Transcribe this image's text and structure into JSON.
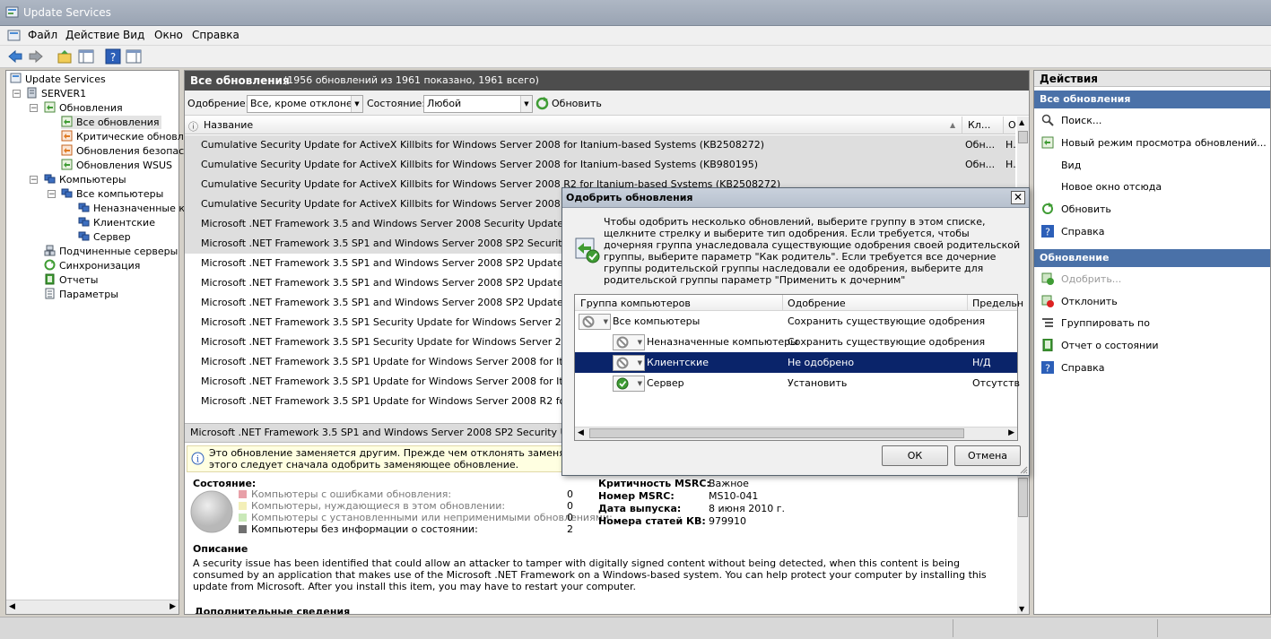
{
  "window": {
    "title": "Update Services"
  },
  "menu": [
    "Файл",
    "Действие",
    "Вид",
    "Окно",
    "Справка"
  ],
  "tree": {
    "root": "Update Services",
    "server": "SERVER1",
    "updates": "Обновления",
    "updates_children": [
      "Все обновления",
      "Критические обновле",
      "Обновления безопасн",
      "Обновления WSUS"
    ],
    "computers": "Компьютеры",
    "all_computers": "Все компьютеры",
    "computer_groups": [
      "Неназначенные к",
      "Клиентские",
      "Сервер"
    ],
    "other": [
      "Подчиненные серверы",
      "Синхронизация",
      "Отчеты",
      "Параметры"
    ]
  },
  "center": {
    "title": "Все обновления",
    "count": "(1956 обновлений из 1961 показано, 1961 всего)",
    "approval_label": "Одобрение:",
    "approval_value": "Все, кроме отклонен",
    "status_label": "Состояние:",
    "status_value": "Любой",
    "refresh_label": "Обновить",
    "columns": {
      "name": "Название",
      "classification": "Кл...",
      "approval": "О"
    },
    "rows": [
      {
        "name": "Cumulative Security Update for ActiveX Killbits for Windows Server 2008 for Itanium-based Systems (KB2508272)",
        "c1": "Обн...",
        "c2": "Н..",
        "grey": true
      },
      {
        "name": "Cumulative Security Update for ActiveX Killbits for Windows Server 2008 for Itanium-based Systems (KB980195)",
        "c1": "Обн...",
        "c2": "Н..",
        "grey": true
      },
      {
        "name": "Cumulative Security Update for ActiveX Killbits for Windows Server 2008 R2 for Itanium-based Systems (KB2508272)",
        "c1": "",
        "c2": "",
        "grey": true
      },
      {
        "name": "Cumulative Security Update for ActiveX Killbits for Windows Server 2008 R2 for Itaniu",
        "c1": "",
        "c2": "",
        "grey": true
      },
      {
        "name": "Microsoft .NET Framework 3.5 and Windows Server 2008 Security Update for Itaniu",
        "c1": "",
        "c2": "",
        "grey": true
      },
      {
        "name": "Microsoft .NET Framework 3.5 SP1 and Windows Server 2008 SP2 Security Update",
        "c1": "",
        "c2": "",
        "grey": true
      },
      {
        "name": "Microsoft .NET Framework 3.5 SP1 and Windows Server 2008 SP2 Update for Itaniu",
        "c1": "",
        "c2": "",
        "grey": false
      },
      {
        "name": "Microsoft .NET Framework 3.5 SP1 and Windows Server 2008 SP2 Update for Itaniu",
        "c1": "",
        "c2": "",
        "grey": false
      },
      {
        "name": "Microsoft .NET Framework 3.5 SP1 and Windows Server 2008 SP2 Update for Itaniu",
        "c1": "",
        "c2": "",
        "grey": false
      },
      {
        "name": "Microsoft .NET Framework 3.5 SP1 Security Update for Windows Server 2008 for It",
        "c1": "",
        "c2": "",
        "grey": false
      },
      {
        "name": "Microsoft .NET Framework 3.5 SP1 Security Update for Windows Server 2008 R2 fo",
        "c1": "",
        "c2": "",
        "grey": false
      },
      {
        "name": "Microsoft .NET Framework 3.5 SP1 Update for Windows Server 2008 for Itanium-ba",
        "c1": "",
        "c2": "",
        "grey": false
      },
      {
        "name": "Microsoft .NET Framework 3.5 SP1 Update for Windows Server 2008 for Itanium-ba",
        "c1": "",
        "c2": "",
        "grey": false
      },
      {
        "name": "Microsoft .NET Framework 3.5 SP1 Update for Windows Server 2008 R2 for Itanium",
        "c1": "",
        "c2": "",
        "grey": false
      }
    ],
    "selected_title": "Microsoft .NET Framework 3.5 SP1 and Windows Server 2008 SP2 Security Update for",
    "info_line1": "Это обновление заменяется другим. Прежде чем отклонять заменяемое обнов",
    "info_line2": "этого следует сначала одобрить заменяющее обновление.",
    "status_heading": "Состояние:",
    "status_items": [
      {
        "label": "Компьютеры с ошибками обновления:",
        "value": "0",
        "color": "#e8a0a8"
      },
      {
        "label": "Компьютеры, нуждающиеся в этом обновлении:",
        "value": "0",
        "color": "#f3efb8"
      },
      {
        "label": "Компьютеры с установленными или неприменимыми обновлениями:",
        "value": "0",
        "color": "#c9e8b8"
      },
      {
        "label": "Компьютеры без информации о состоянии:",
        "value": "2",
        "color": "#707070"
      }
    ],
    "props": [
      {
        "k": "Критичность MSRC:",
        "v": "Важное"
      },
      {
        "k": "Номер MSRC:",
        "v": "MS10-041"
      },
      {
        "k": "Дата выпуска:",
        "v": "8 июня 2010 г."
      },
      {
        "k": "Номера статей КВ:",
        "v": "979910"
      }
    ],
    "desc_heading": "Описание",
    "description": "A security issue has been identified that could allow an attacker to tamper with digitally signed content without being detected, when this content is being consumed by an application that makes use of the Microsoft .NET Framework on a Windows-based system. You can help protect your computer by installing this update from Microsoft. After you install this item, you may have to restart your computer.",
    "more_heading": "Дополнительные сведения"
  },
  "actions": {
    "title": "Действия",
    "section1": "Все обновления",
    "items1": [
      "Поиск...",
      "Новый режим просмотра обновлений...",
      "Вид",
      "Новое окно отсюда",
      "Обновить",
      "Справка"
    ],
    "section2": "Обновление",
    "items2": [
      "Одобрить...",
      "Отклонить",
      "Группировать по",
      "Отчет о состоянии",
      "Справка"
    ]
  },
  "dialog": {
    "title": "Одобрить обновления",
    "close": "✕",
    "text": "Чтобы одобрить несколько обновлений, выберите группу в этом списке, щелкните стрелку и выберите тип одобрения. Если требуется, чтобы дочерняя группа унаследовала существующие одобрения своей родительской группы, выберите параметр \"Как родитель\". Если требуется все дочерние группы родительской группы наследовали ее одобрения, выберите для родительской группы параметр \"Применить к дочерним\"",
    "columns": {
      "group": "Группа компьютеров",
      "approval": "Одобрение",
      "deadline": "Предельн"
    },
    "rows": [
      {
        "group": "Все компьютеры",
        "approval": "Сохранить существующие одобрения",
        "deadline": "",
        "status": "none",
        "selected": false
      },
      {
        "group": "Неназначенные компьютеры",
        "approval": "Сохранить существующие одобрения",
        "deadline": "",
        "status": "none",
        "selected": false
      },
      {
        "group": "Клиентские",
        "approval": "Не одобрено",
        "deadline": "Н/Д",
        "status": "none",
        "selected": true
      },
      {
        "group": "Сервер",
        "approval": "Установить",
        "deadline": "Отсутств",
        "status": "ok",
        "selected": false
      }
    ],
    "ok": "ОК",
    "cancel": "Отмена"
  }
}
